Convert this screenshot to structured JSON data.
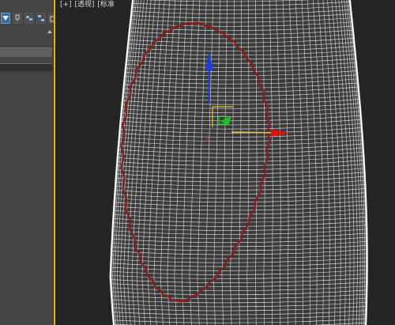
{
  "viewport": {
    "labels": [
      "[+]",
      "[透视]",
      "[标准"
    ],
    "border_color": "#e8b400",
    "wire_color": "#e6e6e6",
    "selection_color": "#8a1e1e"
  },
  "command_panel": {
    "toolbar": [
      {
        "icon": "funnel-filter-icon",
        "active": true
      },
      {
        "icon": "pin-stack-icon",
        "active": false
      },
      {
        "icon": "show-end-result-icon",
        "active": false
      },
      {
        "icon": "make-unique-icon",
        "active": false
      },
      {
        "icon": "remove-modifier-icon",
        "active": false
      }
    ]
  },
  "gizmo": {
    "axes": [
      "X",
      "Y",
      "Z"
    ],
    "colors": {
      "x": "#e01010",
      "y": "#1a3fe0",
      "z": "#20c020",
      "plane": "#f0d000"
    }
  }
}
